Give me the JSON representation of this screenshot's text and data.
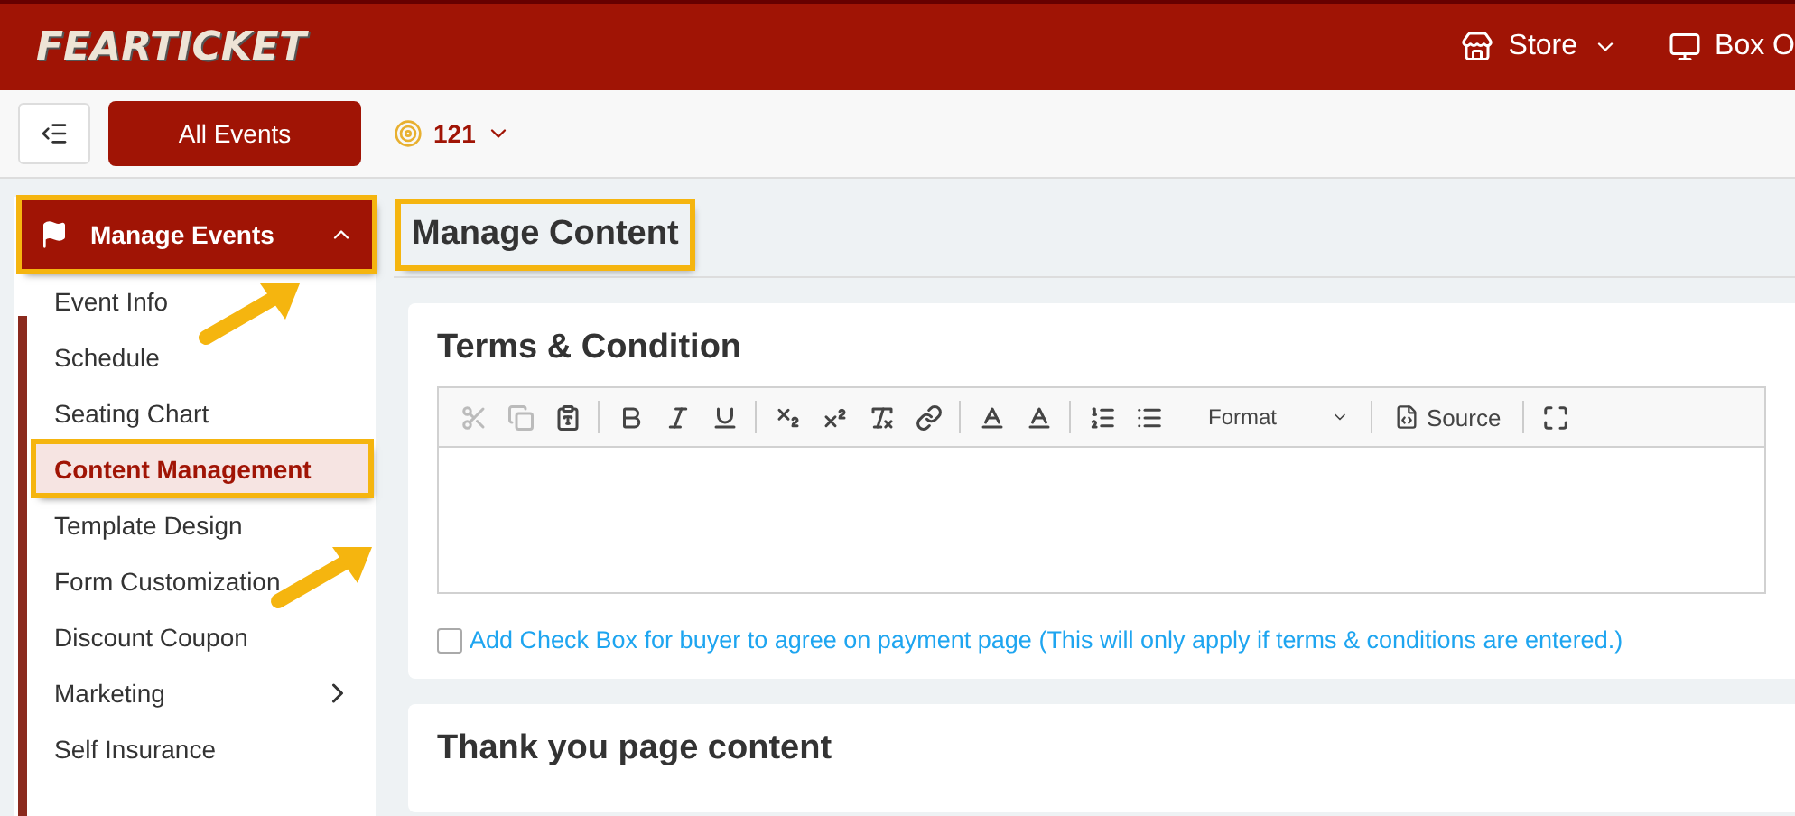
{
  "header": {
    "logo": "FEARTICKET",
    "menus": [
      {
        "label": "Store"
      },
      {
        "label": "Box O"
      }
    ]
  },
  "toolbar": {
    "all_events": "All Events",
    "count": "121"
  },
  "sidebar": {
    "section": {
      "label": "Manage Events",
      "expanded": true,
      "highlighted": true
    },
    "items": [
      {
        "label": "Event Info",
        "selected": false,
        "highlighted": false,
        "has_submenu": false
      },
      {
        "label": "Schedule",
        "selected": false,
        "highlighted": false,
        "has_submenu": false
      },
      {
        "label": "Seating Chart",
        "selected": false,
        "highlighted": false,
        "has_submenu": false
      },
      {
        "label": "Content Management",
        "selected": true,
        "highlighted": true,
        "has_submenu": false
      },
      {
        "label": "Template Design",
        "selected": false,
        "highlighted": false,
        "has_submenu": false
      },
      {
        "label": "Form Customization",
        "selected": false,
        "highlighted": false,
        "has_submenu": false
      },
      {
        "label": "Discount Coupon",
        "selected": false,
        "highlighted": false,
        "has_submenu": false
      },
      {
        "label": "Marketing",
        "selected": false,
        "highlighted": false,
        "has_submenu": true
      },
      {
        "label": "Self Insurance",
        "selected": false,
        "highlighted": false,
        "has_submenu": false
      }
    ]
  },
  "page_title": {
    "text": "Manage Content",
    "highlighted": true
  },
  "terms_card": {
    "title": "Terms & Condition",
    "editor_buttons": [
      {
        "disabled": true
      },
      {
        "disabled": true
      },
      {
        "disabled": false
      },
      {
        "disabled": false
      },
      {
        "disabled": false
      },
      {
        "disabled": false
      },
      {
        "disabled": false
      },
      {
        "disabled": false
      },
      {
        "disabled": false
      },
      {
        "disabled": false
      },
      {
        "disabled": false
      },
      {
        "disabled": false
      },
      {
        "disabled": false
      },
      {
        "disabled": false
      }
    ],
    "format_label": "Format",
    "source_label": "Source",
    "agree_checkbox": {
      "label": "Add Check Box for buyer to agree on payment page (This will only apply if terms & conditions are entered.)",
      "checked": false
    }
  },
  "thank_you_card": {
    "title": "Thank you page content"
  }
}
